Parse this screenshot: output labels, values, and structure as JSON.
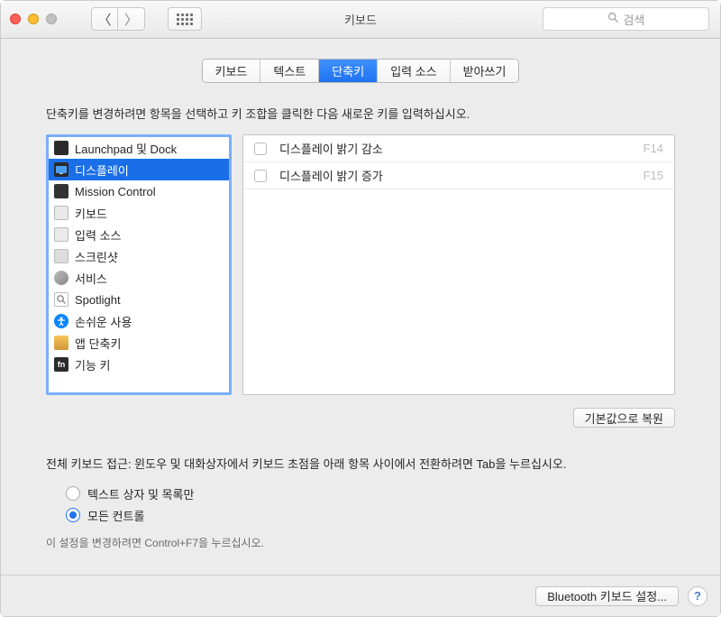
{
  "titlebar": {
    "title": "키보드",
    "search_placeholder": "검색"
  },
  "tabs": {
    "keyboard": "키보드",
    "text": "텍스트",
    "shortcuts": "단축키",
    "input_sources": "입력 소스",
    "dictation": "받아쓰기"
  },
  "instruction": "단축키를 변경하려면 항목을 선택하고 키 조합을 클릭한 다음 새로운 키를 입력하십시오.",
  "categories": {
    "launchpad": "Launchpad 및 Dock",
    "display": "디스플레이",
    "mission_control": "Mission Control",
    "keyboard": "키보드",
    "input_sources": "입력 소스",
    "screenshots": "스크린샷",
    "services": "서비스",
    "spotlight": "Spotlight",
    "accessibility": "손쉬운 사용",
    "app_shortcuts": "앱 단축키",
    "function_keys": "기능 키"
  },
  "fn_label": "fn",
  "detail": {
    "rows": [
      {
        "checked": false,
        "label": "디스플레이 밝기 감소",
        "key": "F14"
      },
      {
        "checked": false,
        "label": "디스플레이 밝기 증가",
        "key": "F15"
      }
    ]
  },
  "restore_defaults": "기본값으로 복원",
  "full_keyboard": {
    "instruction": "전체 키보드 접근: 윈도우 및 대화상자에서 키보드 초점을 아래 항목 사이에서 전환하려면 Tab을 누르십시오.",
    "option_text": "텍스트 상자 및 목록만",
    "option_all": "모든 컨트롤",
    "hint": "이 설정을 변경하려면 Control+F7을 누르십시오."
  },
  "footer": {
    "bluetooth": "Bluetooth 키보드 설정..."
  }
}
